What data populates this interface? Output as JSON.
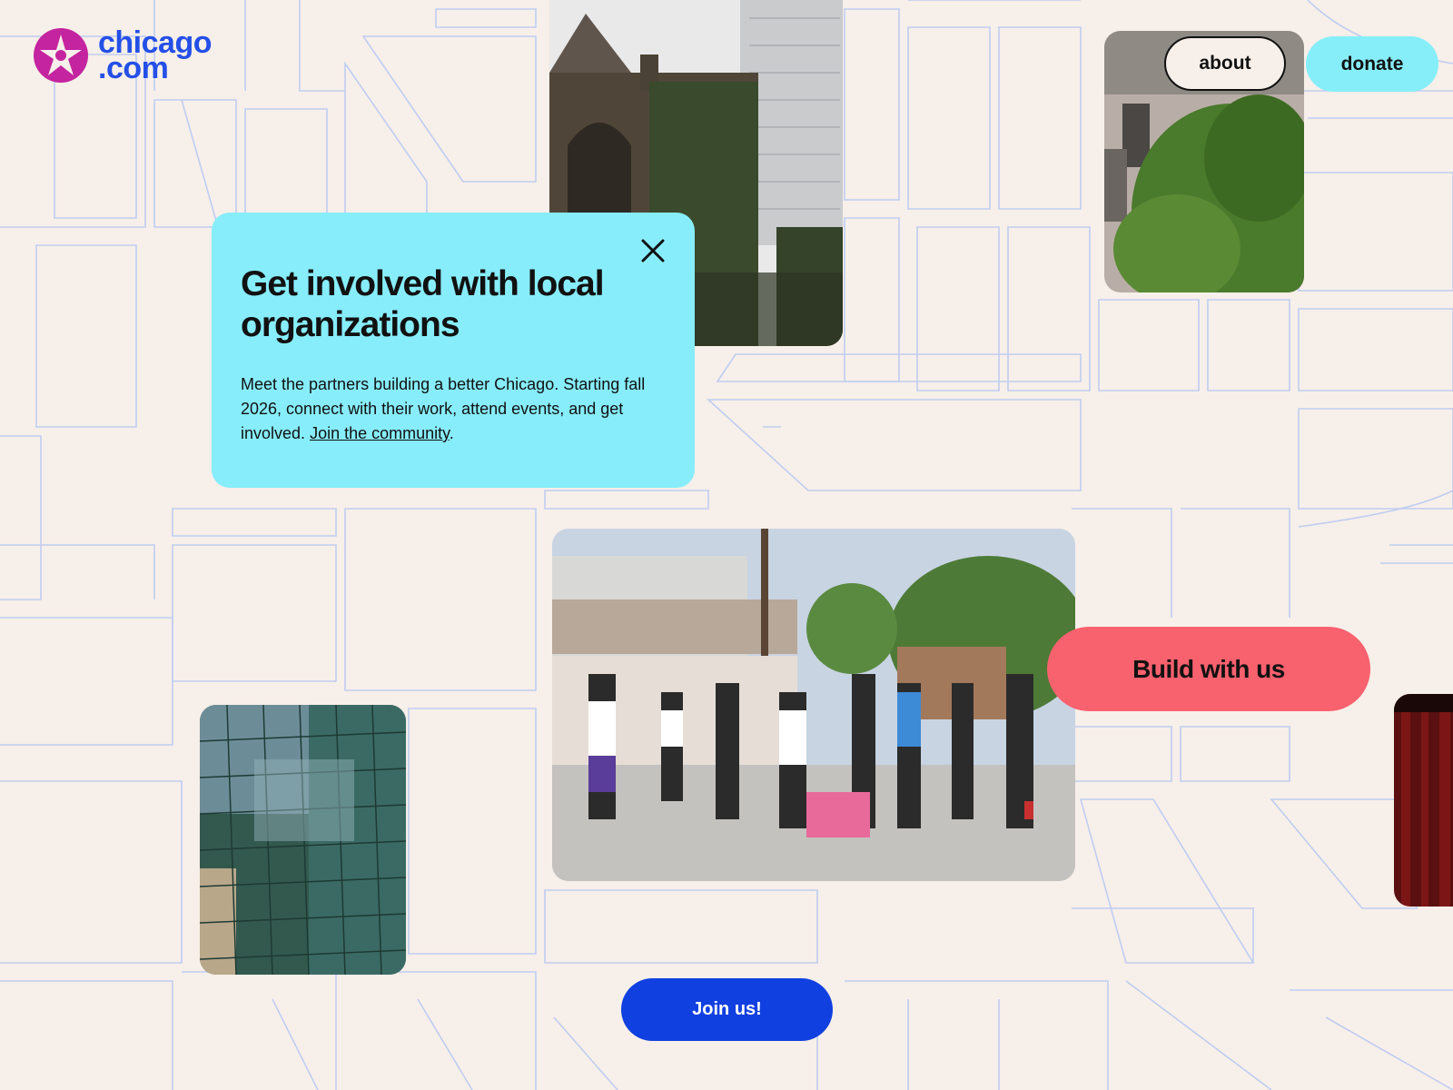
{
  "brand": {
    "line1": "chicago",
    "line2": ".com",
    "logo_icon": "star-in-circle-logo-icon",
    "color": "#2450e8",
    "mark_color": "#c4249f"
  },
  "nav": {
    "about_label": "about",
    "donate_label": "donate"
  },
  "card": {
    "title": "Get involved with local organizations",
    "body": "Meet the partners building a better Chicago. Starting fall 2026, connect with their work, attend events, and get involved.",
    "link_text": "Join the community",
    "after_link": ".",
    "close_icon": "close-icon",
    "background": "#87edfb"
  },
  "cta": {
    "build_label": "Build with us",
    "join_label": "Join us!",
    "build_color": "#f8616e",
    "join_color": "#1140e0"
  },
  "photos": [
    {
      "name": "church-photo",
      "subject": "gothic church beside skyscraper"
    },
    {
      "name": "brick-building-photo",
      "subject": "brick rowhouse with tree"
    },
    {
      "name": "community-event-photo",
      "subject": "outdoor community gathering"
    },
    {
      "name": "glass-tower-photo",
      "subject": "glass skyscraper reflection"
    },
    {
      "name": "theater-curtain-photo",
      "subject": "red curtain"
    }
  ]
}
